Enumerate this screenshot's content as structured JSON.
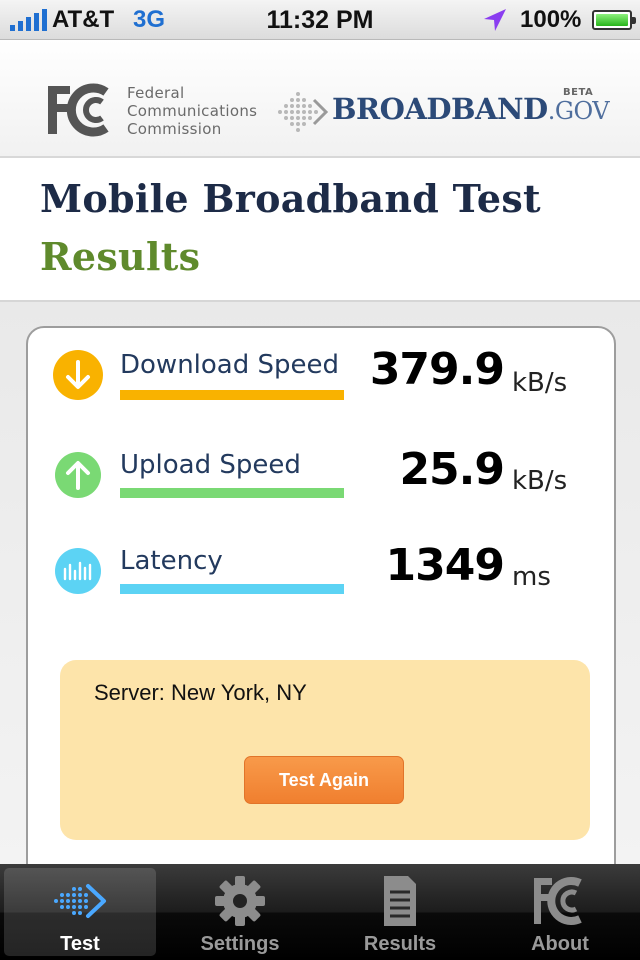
{
  "status_bar": {
    "carrier": "AT&T",
    "network": "3G",
    "time": "11:32 PM",
    "battery": "100%",
    "icons": [
      "signal-icon",
      "location-arrow-icon",
      "battery-icon"
    ]
  },
  "header": {
    "fcc_logo_text": [
      "Federal",
      "Communications",
      "Commission"
    ],
    "broadband_brand": "BROADBAND",
    "broadband_suffix": ".GOV",
    "beta": "BETA"
  },
  "title": {
    "main": "Mobile Broadband Test",
    "sub": "Results"
  },
  "metrics": [
    {
      "label": "Download Speed",
      "value": "379.9",
      "unit": "kB/s",
      "color": "#f9b200",
      "icon": "arrow-down-icon"
    },
    {
      "label": "Upload Speed",
      "value": "25.9",
      "unit": "kB/s",
      "color": "#7ad974",
      "icon": "arrow-up-icon"
    },
    {
      "label": "Latency",
      "value": "1349",
      "unit": "ms",
      "color": "#5cd3f4",
      "icon": "latency-bars-icon"
    }
  ],
  "server": {
    "text": "Server: New York, NY",
    "button_label": "Test Again"
  },
  "tabs": [
    {
      "label": "Test",
      "icon": "test-arrow-icon",
      "active": true
    },
    {
      "label": "Settings",
      "icon": "gear-icon",
      "active": false
    },
    {
      "label": "Results",
      "icon": "document-icon",
      "active": false
    },
    {
      "label": "About",
      "icon": "fcc-logo-icon",
      "active": false
    }
  ],
  "colors": {
    "accent_orange": "#f08a3a",
    "server_box": "#fde4aa",
    "title_navy": "#1d2b47",
    "title_green": "#5f8a2c"
  }
}
